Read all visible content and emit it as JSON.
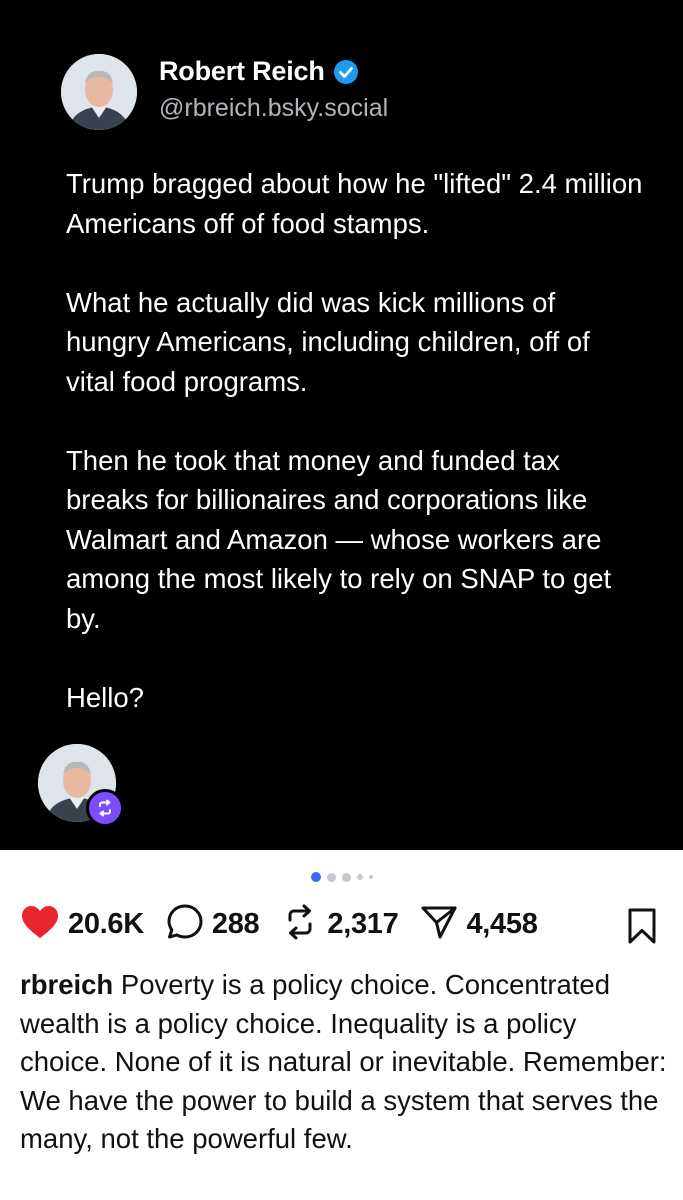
{
  "post": {
    "author_name": "Robert Reich",
    "author_handle": "@rbreich.bsky.social",
    "paragraphs": [
      "Trump bragged about how he \"lifted\" 2.4 million Americans off of food stamps.",
      "What he actually did was kick millions of hungry Americans, including children, off of vital food programs.",
      "Then he took that money and funded tax breaks for billionaires and corporations like Walmart and Amazon — whose workers are among the most likely to rely on SNAP to get by.",
      "Hello?"
    ],
    "verified_icon": "verified-badge-icon",
    "repost_icon": "repost-icon"
  },
  "carousel": {
    "count": 5,
    "active_index": 0
  },
  "actions": {
    "likes": "20.6K",
    "comments": "288",
    "reposts": "2,317",
    "shares": "4,458"
  },
  "caption": {
    "username": "rbreich",
    "text": "Poverty is a policy choice. Concentrated wealth is a policy choice. Inequality is a policy choice. None of it is natural or inevitable. Remember: We have the power to build a system that serves the many, not the powerful few."
  },
  "colors": {
    "like": "#e8252f",
    "verified": "#1d9bf0",
    "repost_badge": "#7c4dff",
    "carousel_active": "#3b6cf0"
  }
}
